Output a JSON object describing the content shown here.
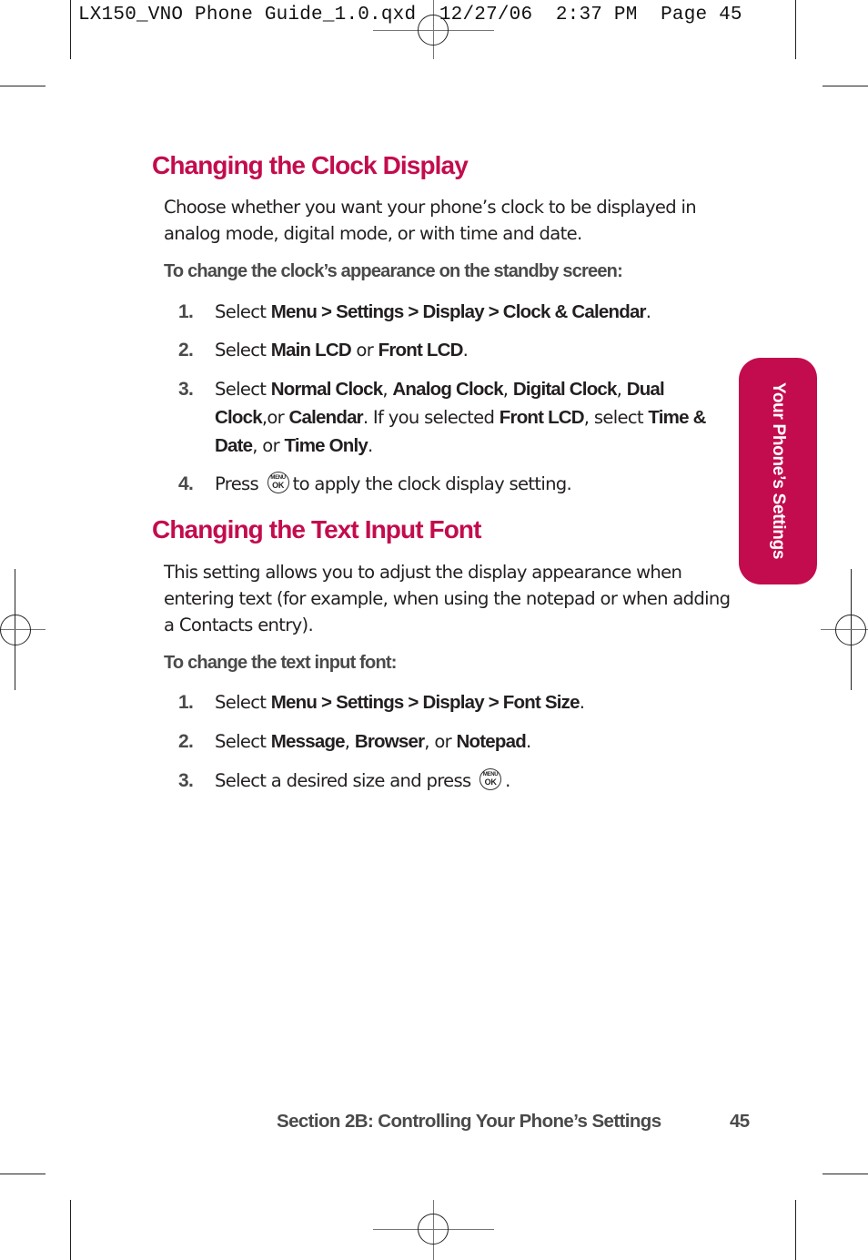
{
  "slug": "LX150_VNO Phone Guide_1.0.qxd  12/27/06  2:37 PM  Page 45",
  "side_tab": {
    "label": "Your Phone’s Settings",
    "color": "#c30c4d"
  },
  "sections": [
    {
      "title": "Changing the Clock Display",
      "intro": "Choose whether you want your phone’s clock to be displayed in analog mode, digital mode, or with time and date.",
      "lead": "To change the clock’s appearance on the standby screen:",
      "steps": [
        {
          "num": "1.",
          "parts": [
            "Select ",
            "Menu > Settings > Display > Clock & Calendar",
            "."
          ]
        },
        {
          "num": "2.",
          "parts": [
            "Select ",
            "Main LCD",
            " or ",
            "Front LCD",
            "."
          ]
        },
        {
          "num": "3.",
          "parts": [
            "Select ",
            "Normal Clock",
            ", ",
            "Analog Clock",
            ", ",
            "Digital Clock",
            ", ",
            "Dual Clock",
            ",or ",
            "Calendar",
            ". If you selected ",
            "Front LCD",
            ", select ",
            "Time & Date",
            ", or ",
            "Time Only",
            "."
          ]
        },
        {
          "num": "4.",
          "parts": [
            "Press ",
            "to apply the clock display setting."
          ]
        }
      ]
    },
    {
      "title": "Changing the Text Input Font",
      "intro": "This setting allows you to adjust the display appearance when entering text (for example, when using the notepad or when adding a Contacts entry).",
      "lead": "To change the text input font:",
      "steps": [
        {
          "num": "1.",
          "parts": [
            "Select ",
            "Menu > Settings > Display > Font Size",
            "."
          ]
        },
        {
          "num": "2.",
          "parts": [
            "Select ",
            "Message",
            ", ",
            "Browser",
            ", or ",
            "Notepad",
            "."
          ]
        },
        {
          "num": "3.",
          "parts": [
            "Select a desired size and press ",
            "."
          ]
        }
      ]
    }
  ],
  "ok_key": {
    "icon": "menu-ok-key-icon",
    "top": "MENU",
    "bottom": "OK"
  },
  "footer": {
    "section": "Section 2B: Controlling Your Phone’s Settings",
    "page": "45"
  }
}
